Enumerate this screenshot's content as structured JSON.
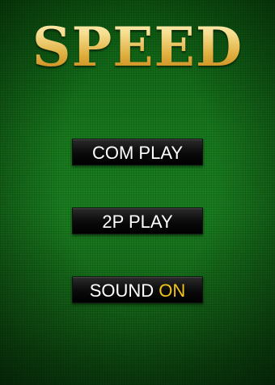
{
  "title": "SPEED",
  "menu": {
    "com_play_label": "COM PLAY",
    "two_player_label": "2P PLAY",
    "sound_label": "SOUND",
    "sound_state": "ON"
  },
  "colors": {
    "felt_green": "#1a7f20",
    "title_gold": "#e0b040",
    "button_black": "#0a0a0a",
    "sound_on_yellow": "#f0c419"
  }
}
